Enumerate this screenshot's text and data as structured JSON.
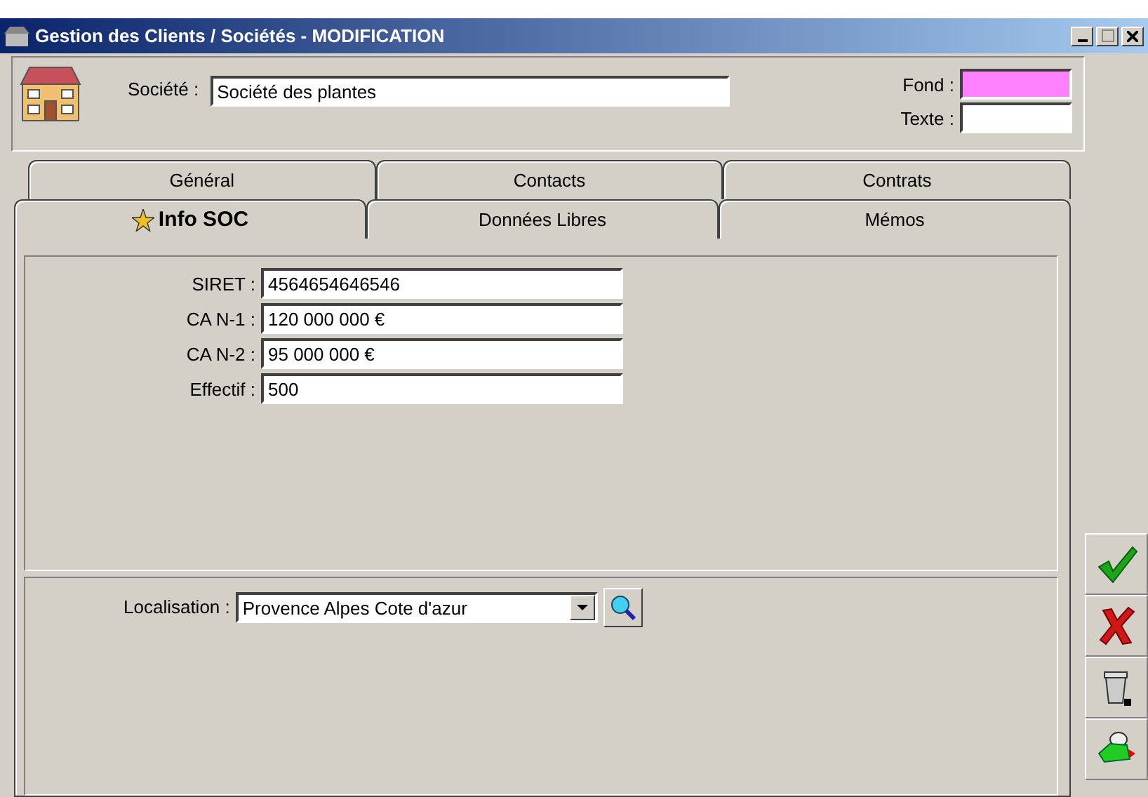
{
  "window": {
    "title": "Gestion des Clients / Sociétés - MODIFICATION"
  },
  "header": {
    "societe_label": "Société :",
    "societe_value": "Société des plantes",
    "swatches": [
      {
        "label": "Fond :",
        "color": "#ff80ff"
      },
      {
        "label": "Texte :",
        "color": "#ffffff"
      }
    ]
  },
  "tabs_back": [
    {
      "label": "Général",
      "selected": false
    },
    {
      "label": "Contacts",
      "selected": false
    },
    {
      "label": "Contrats",
      "selected": false
    }
  ],
  "tabs_front": [
    {
      "label": "Info SOC",
      "selected": true
    },
    {
      "label": "Données Libres",
      "selected": false
    },
    {
      "label": "Mémos",
      "selected": false
    }
  ],
  "fields": [
    {
      "label": "SIRET :",
      "value": "4564654646546"
    },
    {
      "label": "CA N-1 :",
      "value": "120 000 000 €"
    },
    {
      "label": "CA N-2 :",
      "value": "95 000 000 €"
    },
    {
      "label": "Effectif :",
      "value": "500"
    }
  ],
  "localisation": {
    "label": "Localisation :",
    "value": "Provence Alpes Cote d'azur"
  },
  "toolbar": [
    {
      "kind": "validate"
    },
    {
      "kind": "cancel"
    },
    {
      "kind": "delete"
    },
    {
      "kind": "exit"
    }
  ]
}
